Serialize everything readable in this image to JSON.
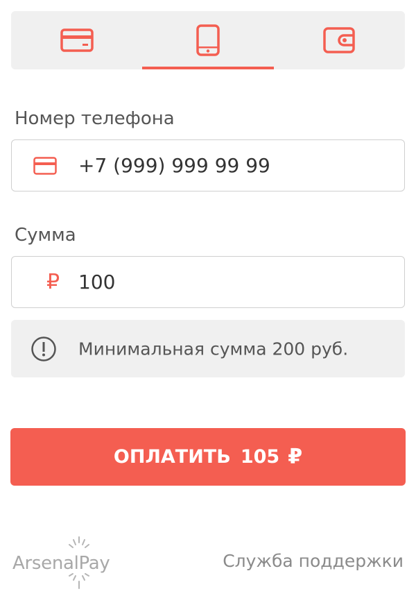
{
  "colors": {
    "accent": "#f45e51",
    "panel_bg": "#f0f0f0",
    "border": "#cfcfcf",
    "muted_text": "#555555"
  },
  "tabs": [
    {
      "icon": "card-icon",
      "active": false
    },
    {
      "icon": "phone-icon",
      "active": true
    },
    {
      "icon": "wallet-icon",
      "active": false
    }
  ],
  "phone": {
    "label": "Номер телефона",
    "value": "+7 (999) 999 99 99",
    "icon": "card-icon"
  },
  "amount": {
    "label": "Сумма",
    "value": "100",
    "currency_glyph": "₽"
  },
  "notice": {
    "icon": "exclamation-circle-icon",
    "text": "Минимальная сумма 200 руб."
  },
  "pay_button": {
    "label": "ОПЛАТИТЬ",
    "amount": "105",
    "currency_glyph": "₽"
  },
  "footer": {
    "logo_text": "ArsenalPay",
    "support_link": "Служба поддержки"
  }
}
